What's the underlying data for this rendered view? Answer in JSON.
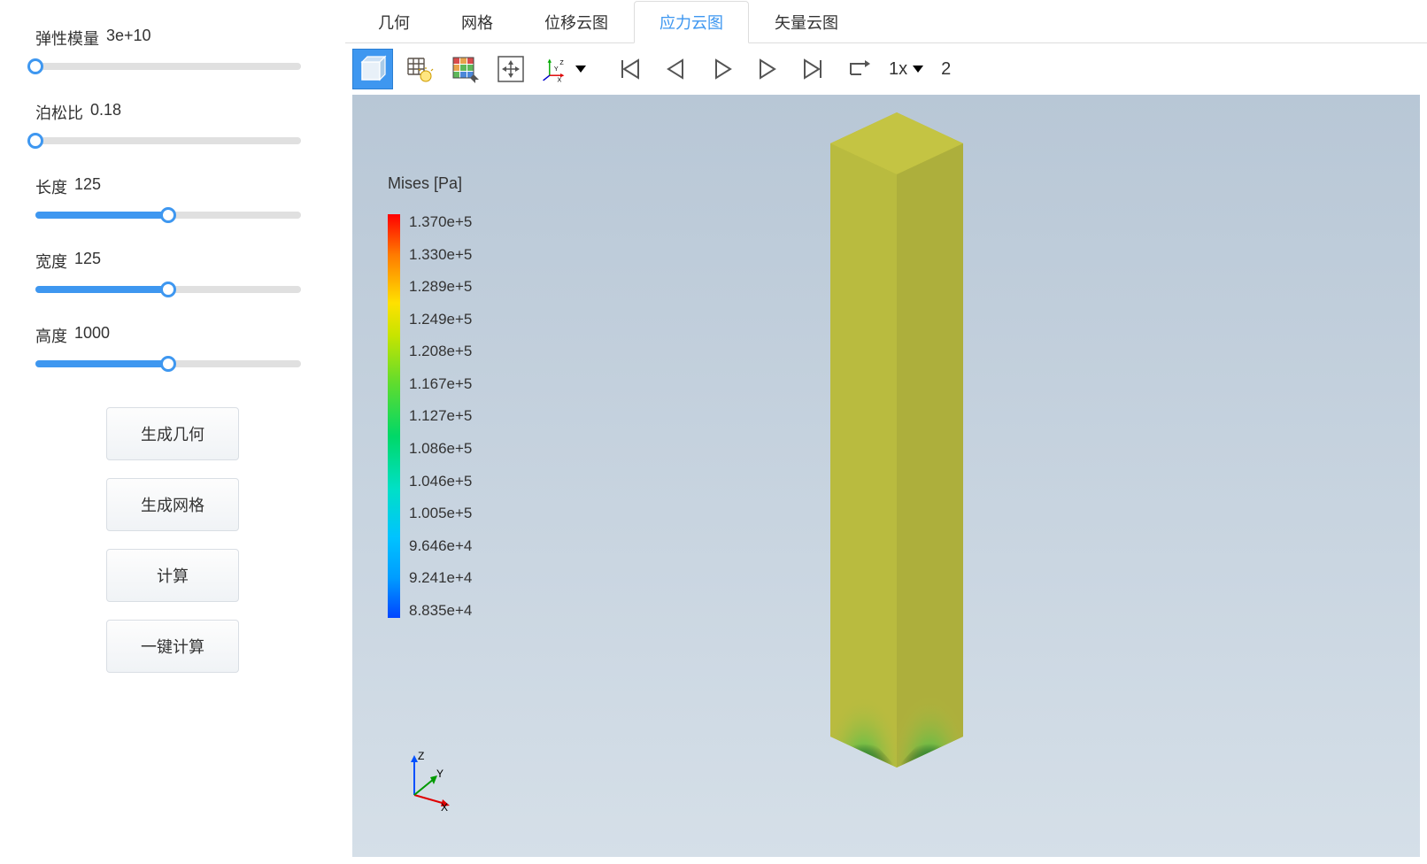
{
  "sidebar": {
    "params": [
      {
        "label": "弹性模量",
        "value": "3e+10",
        "fill": 0
      },
      {
        "label": "泊松比",
        "value": "0.18",
        "fill": 0
      },
      {
        "label": "长度",
        "value": "125",
        "fill": 50
      },
      {
        "label": "宽度",
        "value": "125",
        "fill": 50
      },
      {
        "label": "高度",
        "value": "1000",
        "fill": 50
      }
    ],
    "buttons": [
      "生成几何",
      "生成网格",
      "计算",
      "一键计算"
    ]
  },
  "tabs": [
    "几何",
    "网格",
    "位移云图",
    "应力云图",
    "矢量云图"
  ],
  "active_tab": 3,
  "toolbar": {
    "speed": "1x",
    "frame": "2"
  },
  "legend": {
    "title": "Mises [Pa]",
    "values": [
      "1.370e+5",
      "1.330e+5",
      "1.289e+5",
      "1.249e+5",
      "1.208e+5",
      "1.167e+5",
      "1.127e+5",
      "1.086e+5",
      "1.046e+5",
      "1.005e+5",
      "9.646e+4",
      "9.241e+4",
      "8.835e+4"
    ]
  },
  "axes": {
    "x": "X",
    "y": "Y",
    "z": "Z"
  }
}
